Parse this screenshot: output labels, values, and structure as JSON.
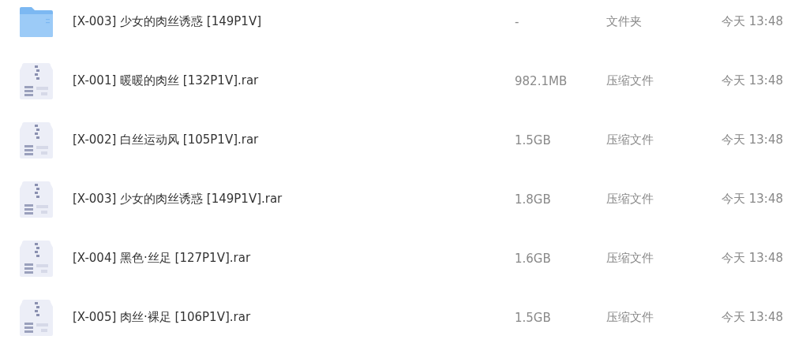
{
  "files": [
    {
      "kind": "folder",
      "name": "[X-003] 少女的肉丝诱惑 [149P1V]",
      "size": "-",
      "type": "文件夹",
      "modified": "今天 13:48"
    },
    {
      "kind": "archive",
      "name": "[X-001] 暖暖的肉丝 [132P1V].rar",
      "size": "982.1MB",
      "type": "压缩文件",
      "modified": "今天 13:48"
    },
    {
      "kind": "archive",
      "name": "[X-002] 白丝运动风 [105P1V].rar",
      "size": "1.5GB",
      "type": "压缩文件",
      "modified": "今天 13:48"
    },
    {
      "kind": "archive",
      "name": "[X-003] 少女的肉丝诱惑 [149P1V].rar",
      "size": "1.8GB",
      "type": "压缩文件",
      "modified": "今天 13:48"
    },
    {
      "kind": "archive",
      "name": "[X-004] 黑色·丝足 [127P1V].rar",
      "size": "1.6GB",
      "type": "压缩文件",
      "modified": "今天 13:48"
    },
    {
      "kind": "archive",
      "name": "[X-005] 肉丝·裸足 [106P1V].rar",
      "size": "1.5GB",
      "type": "压缩文件",
      "modified": "今天 13:48"
    }
  ]
}
